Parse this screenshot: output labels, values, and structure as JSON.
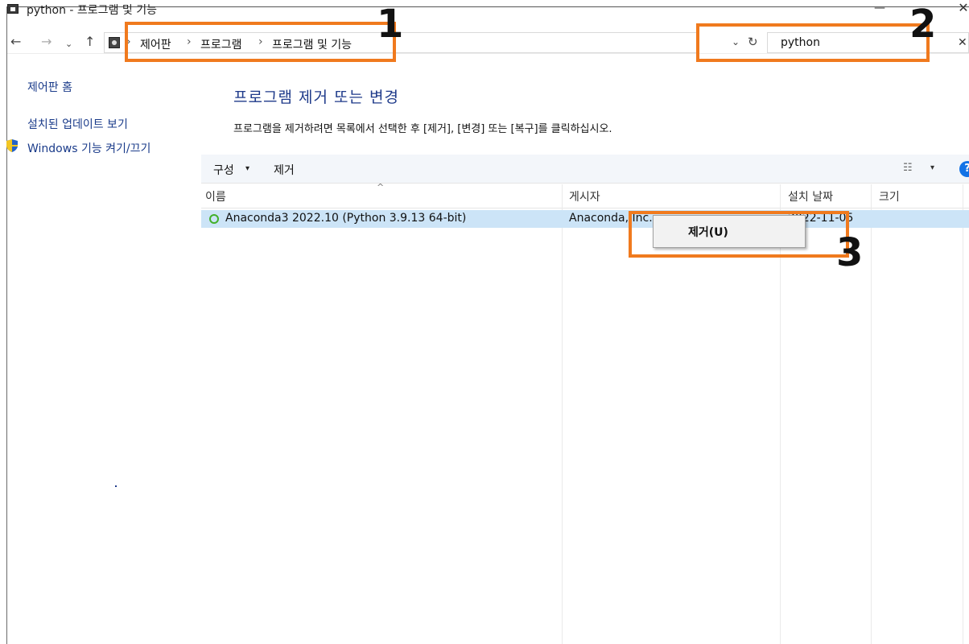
{
  "window": {
    "title": "python - 프로그램 및 기능",
    "minimize_glyph": "—",
    "close_glyph": "✕"
  },
  "nav": {
    "back_icon": "←",
    "forward_icon": "→",
    "recent_icon": "⌄",
    "up_icon": "↑",
    "breadcrumb": [
      "제어판",
      "프로그램",
      "프로그램 및 기능"
    ],
    "separator": "›",
    "dropdown_icon": "⌄",
    "refresh_icon": "↻",
    "search_value": "python",
    "clear_icon": "✕"
  },
  "sidebar": {
    "items": [
      "제어판 홈",
      "설치된 업데이트 보기",
      "Windows 기능 켜기/끄기"
    ]
  },
  "main": {
    "title": "프로그램 제거 또는 변경",
    "description": "프로그램을 제거하려면 목록에서 선택한 후 [제거], [변경] 또는 [복구]를 클릭하십시오."
  },
  "toolbar": {
    "organize_label": "구성",
    "organize_caret": "▾",
    "uninstall_label": "제거",
    "view_icon": "☷",
    "view_caret": "▾",
    "help_icon": "?"
  },
  "table": {
    "sort_caret": "^",
    "columns": [
      "이름",
      "게시자",
      "설치 날짜",
      "크기"
    ],
    "rows": [
      {
        "name": "Anaconda3 2022.10 (Python 3.9.13 64-bit)",
        "publisher": "Anaconda, Inc.",
        "install_date": "2022-11-05",
        "size": ""
      }
    ]
  },
  "context_menu": {
    "items": [
      "제거(U)"
    ]
  },
  "annotations": {
    "color": "#f07a1e",
    "labels": [
      "1",
      "2",
      "3"
    ]
  }
}
